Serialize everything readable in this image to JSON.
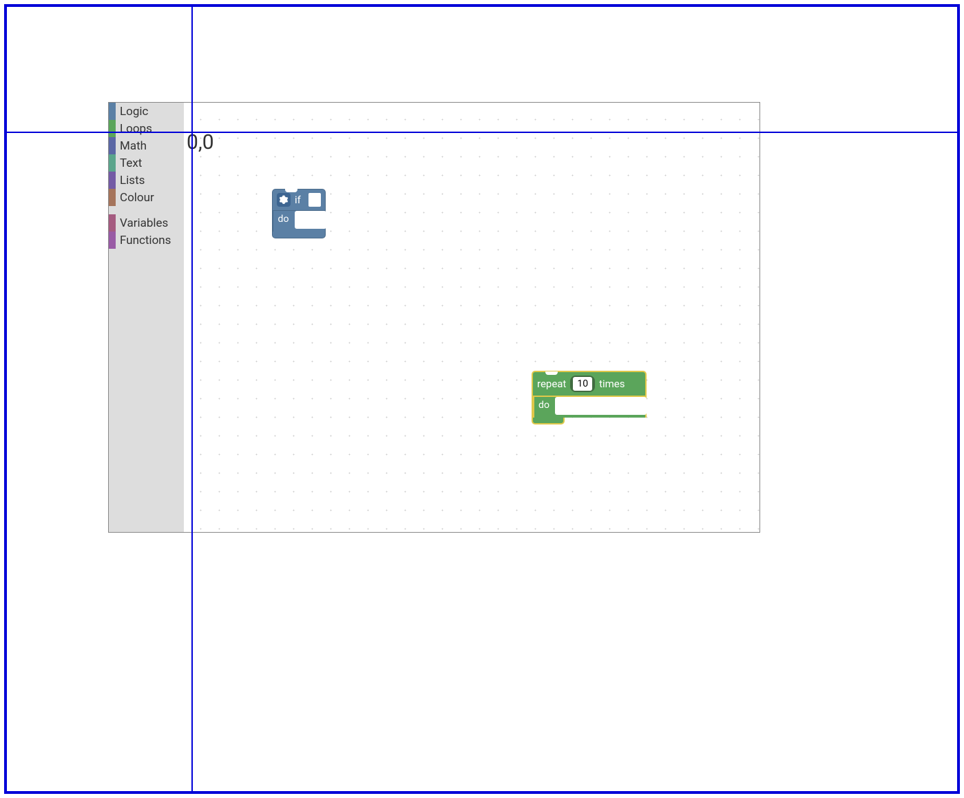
{
  "origin_label": "0,0",
  "toolbox": {
    "categories": [
      {
        "label": "Logic",
        "color": "#5b80a5"
      },
      {
        "label": "Loops",
        "color": "#5ba55b"
      },
      {
        "label": "Math",
        "color": "#5b67a5"
      },
      {
        "label": "Text",
        "color": "#5ba58c"
      },
      {
        "label": "Lists",
        "color": "#745ba5"
      },
      {
        "label": "Colour",
        "color": "#a5745b"
      }
    ],
    "categories2": [
      {
        "label": "Variables",
        "color": "#a55b80"
      },
      {
        "label": "Functions",
        "color": "#995ba5"
      }
    ]
  },
  "blocks": {
    "if_block": {
      "if_label": "if",
      "do_label": "do",
      "gear_icon": "gear-icon"
    },
    "repeat_block": {
      "repeat_label": "repeat",
      "times_label": "times",
      "do_label": "do",
      "count_value": "10"
    }
  }
}
